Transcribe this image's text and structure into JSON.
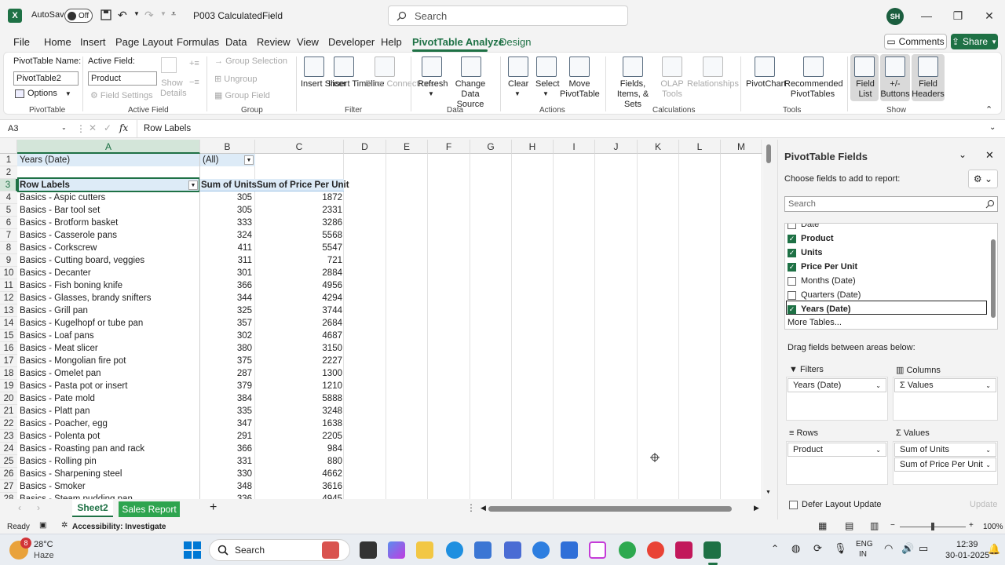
{
  "window": {
    "autosave_label": "AutoSave",
    "autosave_state": "Off",
    "filename": "P003 CalculatedField",
    "search_placeholder": "Search",
    "user_initials": "SH"
  },
  "menu": {
    "items": [
      "File",
      "Home",
      "Insert",
      "Page Layout",
      "Formulas",
      "Data",
      "Review",
      "View",
      "Developer",
      "Help",
      "PivotTable Analyze",
      "Design"
    ],
    "active": "PivotTable Analyze",
    "comments": "Comments",
    "share": "Share"
  },
  "ribbon": {
    "pivottable_name_label": "PivotTable Name:",
    "pivottable_name": "PivotTable2",
    "options": "Options",
    "group_pivottable": "PivotTable",
    "active_field_label": "Active Field:",
    "active_field": "Product",
    "field_settings": "Field Settings",
    "show_details": "Show Details",
    "group_active_field": "Active Field",
    "group_selection": "Group Selection",
    "ungroup": "Ungroup",
    "group_field": "Group Field",
    "group_group": "Group",
    "insert_slicer": "Insert Slicer",
    "insert_timeline": "Insert Timeline",
    "filter_connections": "Filter Connections",
    "group_filter": "Filter",
    "refresh": "Refresh",
    "change_data_source": "Change Data Source",
    "group_data": "Data",
    "clear": "Clear",
    "select": "Select",
    "move_pivottable": "Move PivotTable",
    "group_actions": "Actions",
    "fields_items_sets": "Fields, Items, & Sets",
    "olap_tools": "OLAP Tools",
    "relationships": "Relationships",
    "group_calculations": "Calculations",
    "pivotchart": "PivotChart",
    "recommended_pivottables": "Recommended PivotTables",
    "group_tools": "Tools",
    "field_list": "Field List",
    "buttons": "+/- Buttons",
    "field_headers": "Field Headers",
    "group_show": "Show"
  },
  "formula_bar": {
    "name_box": "A3",
    "fx": "fx",
    "content": "Row Labels"
  },
  "grid": {
    "columns": [
      "A",
      "B",
      "C",
      "D",
      "E",
      "F",
      "G",
      "H",
      "I",
      "J",
      "K",
      "L",
      "M"
    ],
    "row_numbers": [
      "1",
      "2",
      "3",
      "4",
      "5",
      "6",
      "7",
      "8",
      "9",
      "10",
      "11",
      "12",
      "13",
      "14",
      "15",
      "16",
      "17",
      "18",
      "19",
      "20",
      "21",
      "22",
      "23",
      "24",
      "25",
      "26",
      "27",
      "28"
    ],
    "filter_label": "Years (Date)",
    "filter_value": "(All)",
    "header_row_labels": "Row Labels",
    "header_units": "Sum of Units",
    "header_price": "Sum of Price Per Unit",
    "rows": [
      {
        "label": "Basics - Aspic cutters",
        "units": "305",
        "price": "1872"
      },
      {
        "label": "Basics - Bar tool set",
        "units": "305",
        "price": "2331"
      },
      {
        "label": "Basics - Brotform basket",
        "units": "333",
        "price": "3286"
      },
      {
        "label": "Basics - Casserole pans",
        "units": "324",
        "price": "5568"
      },
      {
        "label": "Basics - Corkscrew",
        "units": "411",
        "price": "5547"
      },
      {
        "label": "Basics - Cutting board, veggies",
        "units": "311",
        "price": "721"
      },
      {
        "label": "Basics - Decanter",
        "units": "301",
        "price": "2884"
      },
      {
        "label": "Basics - Fish boning knife",
        "units": "366",
        "price": "4956"
      },
      {
        "label": "Basics - Glasses, brandy snifters",
        "units": "344",
        "price": "4294"
      },
      {
        "label": "Basics - Grill pan",
        "units": "325",
        "price": "3744"
      },
      {
        "label": "Basics - Kugelhopf or tube pan",
        "units": "357",
        "price": "2684"
      },
      {
        "label": "Basics - Loaf pans",
        "units": "302",
        "price": "4687"
      },
      {
        "label": "Basics - Meat slicer",
        "units": "380",
        "price": "3150"
      },
      {
        "label": "Basics - Mongolian fire pot",
        "units": "375",
        "price": "2227"
      },
      {
        "label": "Basics - Omelet pan",
        "units": "287",
        "price": "1300"
      },
      {
        "label": "Basics - Pasta pot or insert",
        "units": "379",
        "price": "1210"
      },
      {
        "label": "Basics - Pate mold",
        "units": "384",
        "price": "5888"
      },
      {
        "label": "Basics - Platt pan",
        "units": "335",
        "price": "3248"
      },
      {
        "label": "Basics - Poacher, egg",
        "units": "347",
        "price": "1638"
      },
      {
        "label": "Basics - Polenta pot",
        "units": "291",
        "price": "2205"
      },
      {
        "label": "Basics - Roasting pan and rack",
        "units": "366",
        "price": "984"
      },
      {
        "label": "Basics - Rolling pin",
        "units": "331",
        "price": "880"
      },
      {
        "label": "Basics - Sharpening steel",
        "units": "330",
        "price": "4662"
      },
      {
        "label": "Basics - Smoker",
        "units": "348",
        "price": "3616"
      },
      {
        "label": "Basics - Steam pudding pan",
        "units": "336",
        "price": "4945"
      }
    ]
  },
  "sheets": {
    "tabs": [
      "Sheet2",
      "Sales Report"
    ],
    "active": "Sheet2"
  },
  "pivot_pane": {
    "title": "PivotTable Fields",
    "subtitle": "Choose fields to add to report:",
    "search_placeholder": "Search",
    "fields": [
      {
        "name": "Date",
        "checked": false,
        "bold": false
      },
      {
        "name": "Product",
        "checked": true,
        "bold": true
      },
      {
        "name": "Units",
        "checked": true,
        "bold": true
      },
      {
        "name": "Price Per Unit",
        "checked": true,
        "bold": true
      },
      {
        "name": "Months (Date)",
        "checked": false,
        "bold": false
      },
      {
        "name": "Quarters (Date)",
        "checked": false,
        "bold": false
      },
      {
        "name": "Years (Date)",
        "checked": true,
        "bold": true
      }
    ],
    "more_tables": "More Tables...",
    "drag_label": "Drag fields between areas below:",
    "filters_label": "Filters",
    "filters_item": "Years (Date)",
    "columns_label": "Columns",
    "columns_item": "Σ Values",
    "rows_label": "Rows",
    "rows_item": "Product",
    "values_label": "Values",
    "values_items": [
      "Sum of Units",
      "Sum of Price Per Unit"
    ],
    "defer_label": "Defer Layout Update",
    "update_label": "Update"
  },
  "status": {
    "ready": "Ready",
    "accessibility": "Accessibility: Investigate",
    "zoom": "100%"
  },
  "taskbar": {
    "weather_temp": "28°C",
    "weather_desc": "Haze",
    "search": "Search",
    "lang1": "ENG",
    "lang2": "IN",
    "time": "12:39",
    "date": "30-01-2025",
    "badge": "8"
  },
  "colors": {
    "accent": "#1e7145",
    "pivot_header": "#ddebf7"
  }
}
